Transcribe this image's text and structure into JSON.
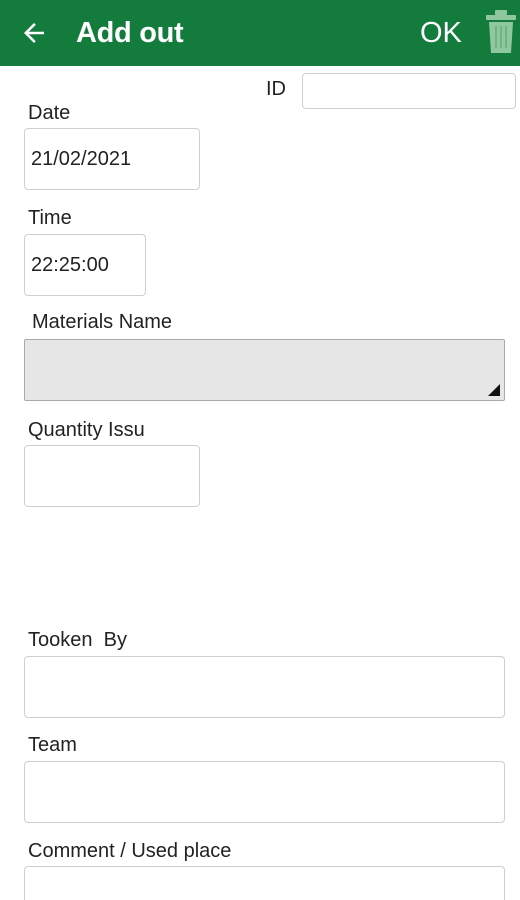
{
  "header": {
    "title": "Add out",
    "ok_label": "OK",
    "back_icon": "arrow-left-icon",
    "delete_icon": "trash-icon",
    "background_color": "#137b3b"
  },
  "form": {
    "id": {
      "label": "ID",
      "value": ""
    },
    "date": {
      "label": "Date",
      "value": "21/02/2021"
    },
    "time": {
      "label": "Time",
      "value": "22:25:00"
    },
    "materials_name": {
      "label": "Materials Name",
      "value": ""
    },
    "quantity_issued": {
      "label": "Quantity Issu",
      "value": ""
    },
    "tooken_by": {
      "label": "Tooken  By",
      "value": ""
    },
    "team": {
      "label": "Team",
      "value": ""
    },
    "comment": {
      "label": "Comment / Used place",
      "value": ""
    }
  }
}
